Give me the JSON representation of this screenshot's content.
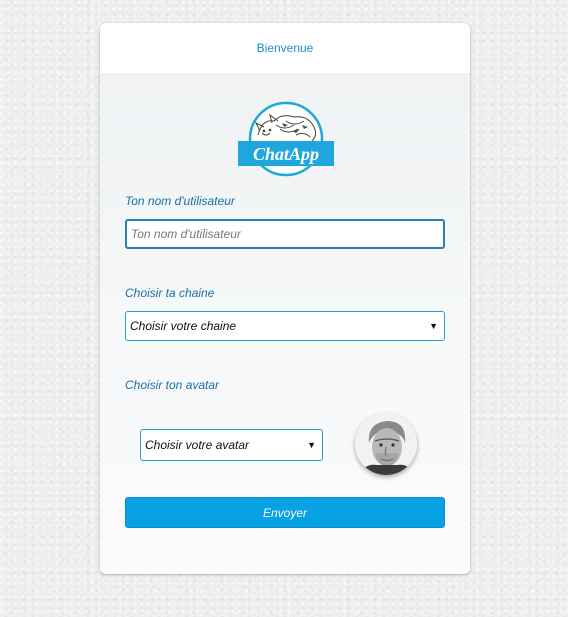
{
  "header": {
    "title": "Bienvenue"
  },
  "logo": {
    "text": "ChatApp",
    "icon": "cat-logo-icon"
  },
  "username": {
    "label": "Ton nom d'utilisateur",
    "placeholder": "Ton nom d'utilisateur",
    "value": ""
  },
  "channel": {
    "label": "Choisir ta chaine",
    "selected": "Choisir votre chaine",
    "arrow_icon": "dropdown-arrow-icon"
  },
  "avatar": {
    "label": "Choisir ton avatar",
    "selected": "Choisir votre avatar",
    "arrow_icon": "dropdown-arrow-icon",
    "preview_icon": "avatar-photo"
  },
  "submit": {
    "label": "Envoyer"
  },
  "colors": {
    "accent": "#07a2e3",
    "label": "#1d6fa3",
    "header_text": "#1b8fd0"
  }
}
